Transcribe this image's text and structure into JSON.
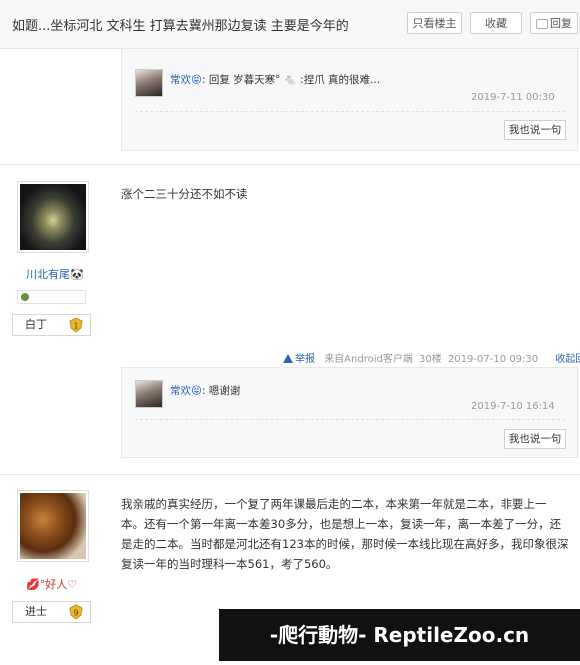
{
  "header": {
    "title": "如题...坐标河北 文科生 打算去冀州那边复读 主要是今年的",
    "only_owner_label": "只看楼主",
    "favorite_label": "收藏",
    "reply_label": "回复"
  },
  "posts": [
    {
      "replies": [
        {
          "user": "常欢😝",
          "text": ": 回复 岁暮天寒° 🐁 :捏爪 真的很难...",
          "reply_prefix": "回复",
          "reply_to": "岁暮天寒°",
          "body": ":捏爪 真的很难...",
          "time": "2019-7-11 00:30"
        }
      ],
      "say_label": "我也说一句"
    },
    {
      "user": "川北有尾🐼",
      "rank": "白丁",
      "rank_level": "1",
      "content": "涨个二三十分还不如不读",
      "report_label": "举报",
      "client": "来自Android客户端",
      "floor": "30楼",
      "time": "2019-07-10 09:30",
      "collapse_label": "收起回复",
      "replies": [
        {
          "user": "常欢😝",
          "body": ": 嗯谢谢",
          "time": "2019-7-10 16:14"
        }
      ],
      "say_label": "我也说一句"
    },
    {
      "user": "💋°好人♡",
      "rank": "进士",
      "rank_level": "9",
      "content": "我亲戚的真实经历，一个复了两年课最后走的二本，本来第一年就是二本，非要上一本。还有一个第一年离一本差30多分，也是想上一本，复读一年，离一本差了一分，还是走的二本。当时都是河北还有123本的时候，那时候一本线比现在高好多，我印象很深复读一年的当时理科一本561，考了560。"
    }
  ],
  "watermark": "-爬行動物-  ReptileZoo.cn",
  "colors": {
    "link": "#2d64b3",
    "meta": "#999999",
    "panel": "#f7f8fa"
  }
}
